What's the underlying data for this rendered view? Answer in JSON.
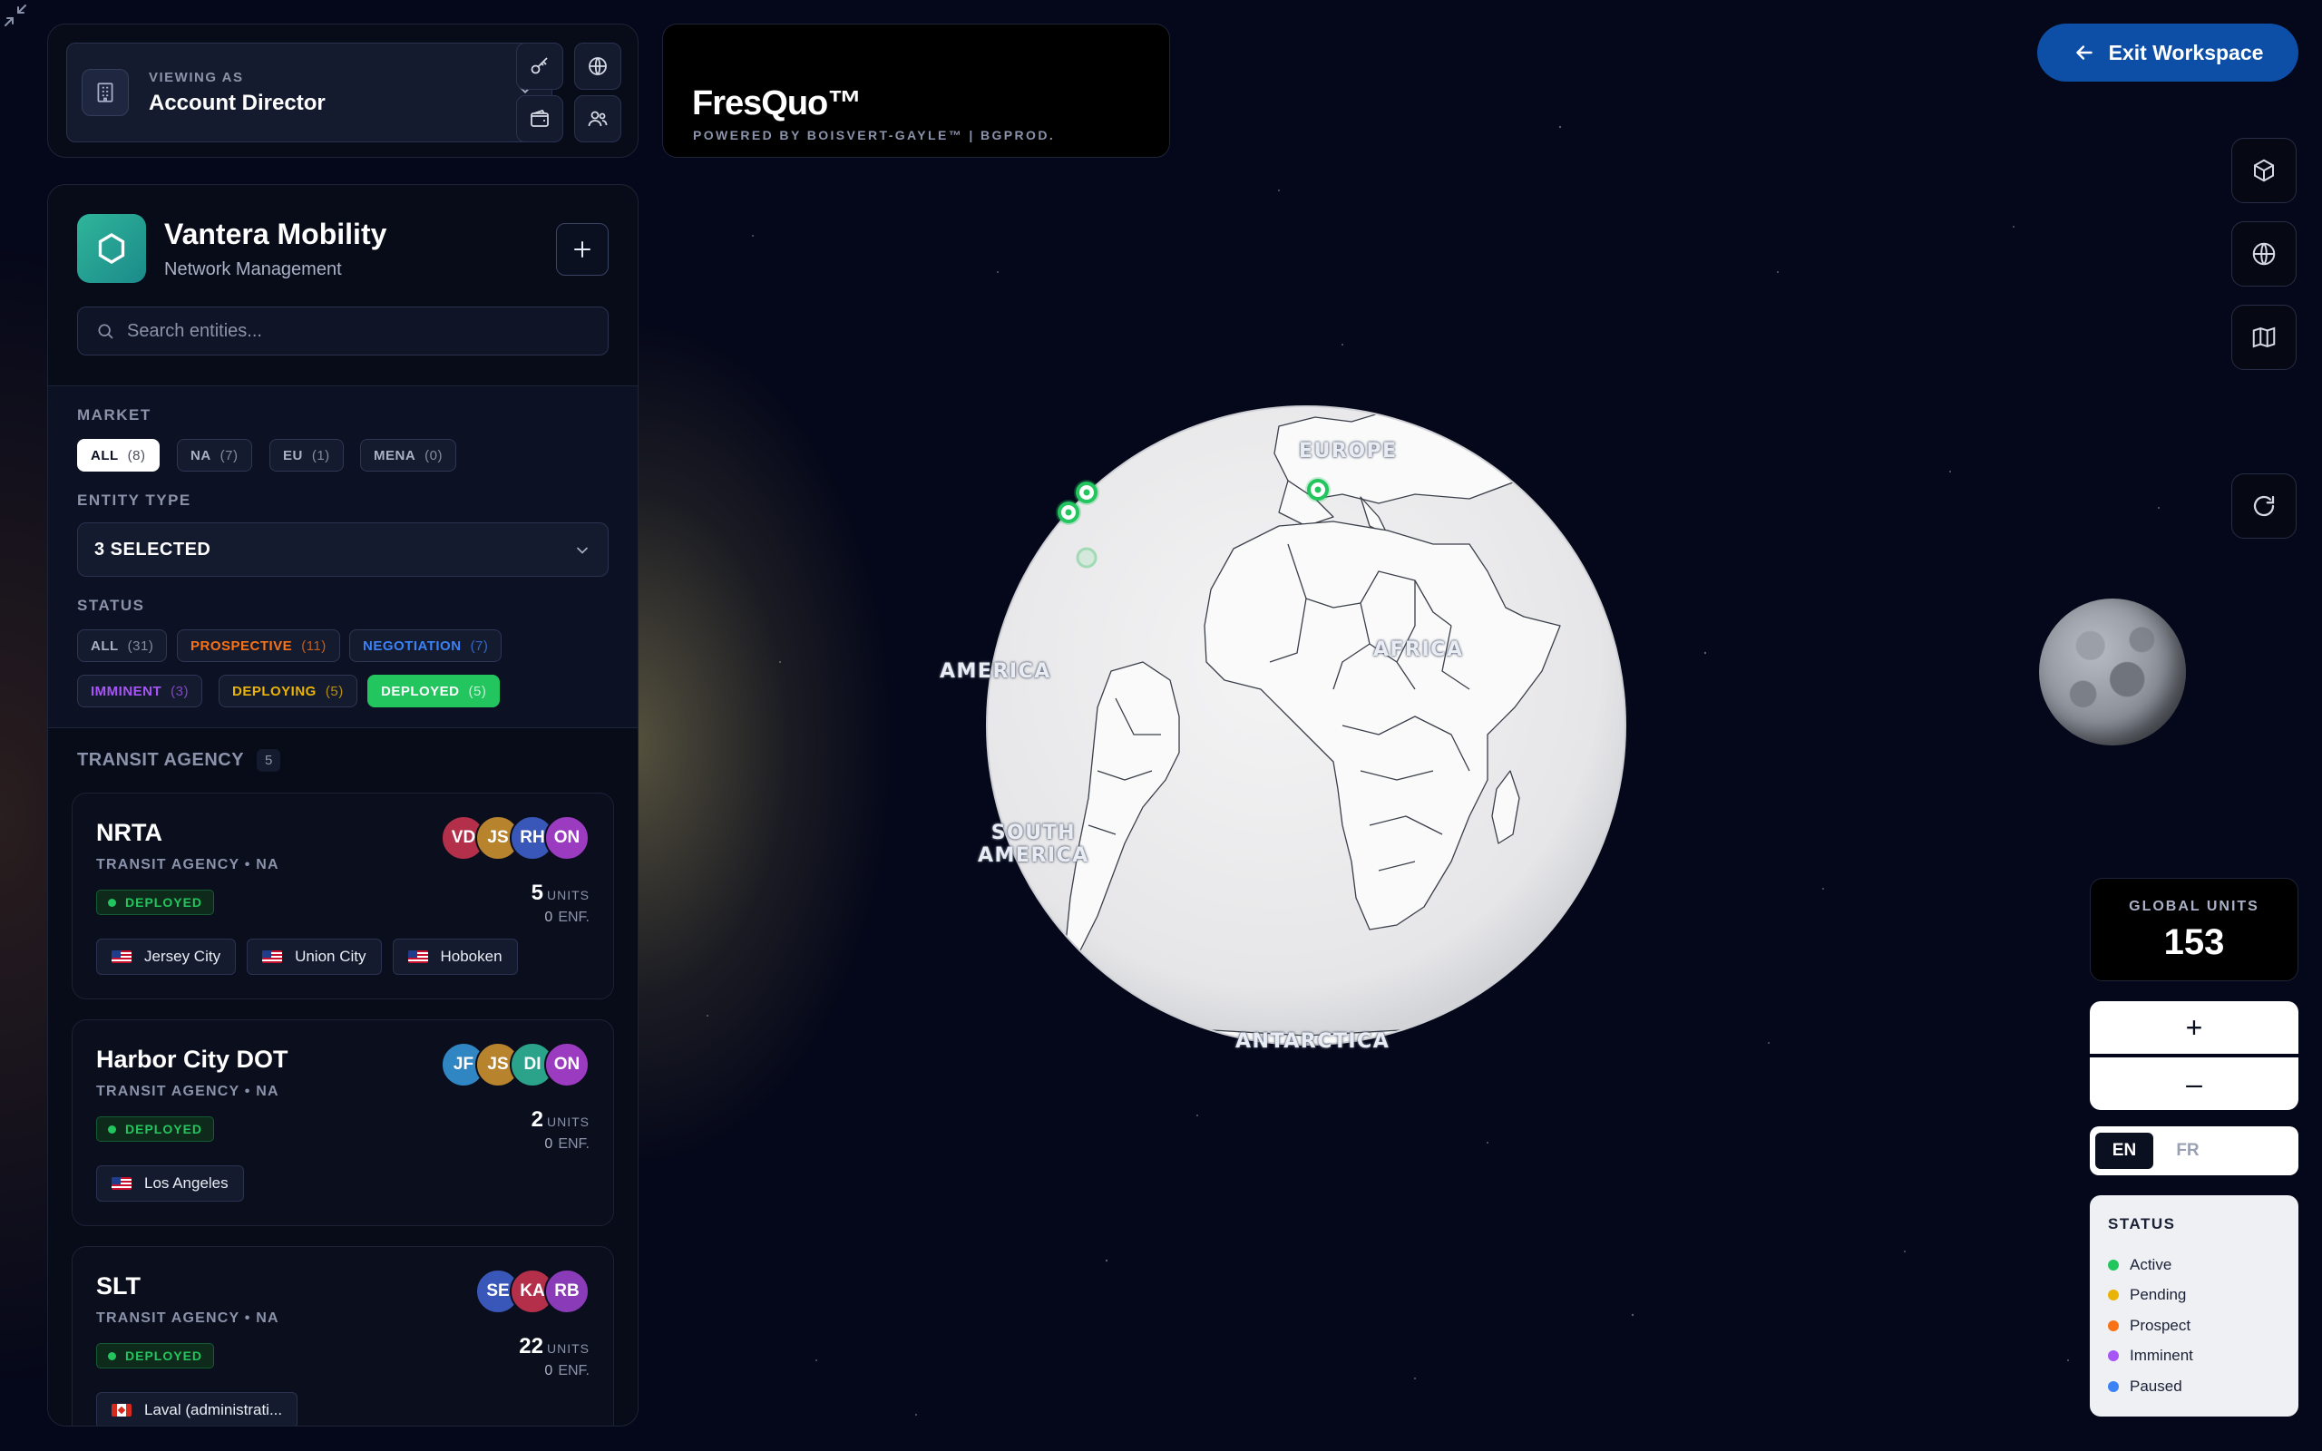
{
  "header": {
    "viewing_label": "VIEWING AS",
    "viewing_value": "Account Director",
    "brand_name": "FresQuo™",
    "brand_sub": "POWERED BY BOISVERT-GAYLE™ | BGPROD.",
    "exit_label": "Exit Workspace"
  },
  "sidebar": {
    "workspace_name": "Vantera Mobility",
    "workspace_sub": "Network Management",
    "search_placeholder": "Search entities...",
    "market_label": "MARKET",
    "market_chips": [
      {
        "label": "ALL",
        "count": "(8)"
      },
      {
        "label": "NA",
        "count": "(7)"
      },
      {
        "label": "EU",
        "count": "(1)"
      },
      {
        "label": "MENA",
        "count": "(0)"
      }
    ],
    "entity_type_label": "ENTITY TYPE",
    "entity_type_value": "3 SELECTED",
    "status_label": "STATUS",
    "status_chips": [
      {
        "label": "ALL",
        "count": "(31)",
        "color": "#aab1c6"
      },
      {
        "label": "PROSPECTIVE",
        "count": "(11)",
        "color": "#f97316"
      },
      {
        "label": "NEGOTIATION",
        "count": "(7)",
        "color": "#3b82f6"
      },
      {
        "label": "IMMINENT",
        "count": "(3)",
        "color": "#a855f7"
      },
      {
        "label": "DEPLOYING",
        "count": "(5)",
        "color": "#eab308"
      },
      {
        "label": "DEPLOYED",
        "count": "(5)",
        "color": "#ffffff"
      }
    ],
    "group_title": "TRANSIT AGENCY",
    "group_count": "5",
    "entities": [
      {
        "name": "NRTA",
        "meta": "TRANSIT AGENCY • NA",
        "status": "DEPLOYED",
        "units": "5",
        "units_label": "UNITS",
        "enf": "0",
        "enf_label": "ENF.",
        "avatars": [
          {
            "initials": "VD",
            "color": "#b4304a"
          },
          {
            "initials": "JS",
            "color": "#b7832c"
          },
          {
            "initials": "RH",
            "color": "#3957b8"
          },
          {
            "initials": "ON",
            "color": "#9b3bbf"
          }
        ],
        "locations": [
          {
            "flag": "us",
            "name": "Jersey City"
          },
          {
            "flag": "us",
            "name": "Union City"
          },
          {
            "flag": "us",
            "name": "Hoboken"
          }
        ]
      },
      {
        "name": "Harbor City DOT",
        "meta": "TRANSIT AGENCY • NA",
        "status": "DEPLOYED",
        "units": "2",
        "units_label": "UNITS",
        "enf": "0",
        "enf_label": "ENF.",
        "avatars": [
          {
            "initials": "JF",
            "color": "#2f86c2"
          },
          {
            "initials": "JS",
            "color": "#b7832c"
          },
          {
            "initials": "DI",
            "color": "#2aa38a"
          },
          {
            "initials": "ON",
            "color": "#9b3bbf"
          }
        ],
        "locations": [
          {
            "flag": "us",
            "name": "Los Angeles"
          }
        ]
      },
      {
        "name": "SLT",
        "meta": "TRANSIT AGENCY • NA",
        "status": "DEPLOYED",
        "units": "22",
        "units_label": "UNITS",
        "enf": "0",
        "enf_label": "ENF.",
        "avatars": [
          {
            "initials": "SE",
            "color": "#3957b8"
          },
          {
            "initials": "KA",
            "color": "#b4304a"
          },
          {
            "initials": "RB",
            "color": "#8a3bb8"
          }
        ],
        "locations": [
          {
            "flag": "ca",
            "name": "Laval (administrati..."
          }
        ]
      }
    ]
  },
  "map": {
    "labels": {
      "europe": "EUROPE",
      "africa": "AFRICA",
      "america": "AMERICA",
      "south_america_1": "SOUTH",
      "south_america_2": "AMERICA",
      "antarctica": "ANTARCTICA"
    }
  },
  "controls": {
    "global_units_label": "GLOBAL UNITS",
    "global_units_value": "153",
    "zoom_in": "+",
    "zoom_out": "–",
    "lang_en": "EN",
    "lang_fr": "FR",
    "legend_title": "STATUS",
    "legend": [
      {
        "label": "Active",
        "color": "#22c55e"
      },
      {
        "label": "Pending",
        "color": "#eab308"
      },
      {
        "label": "Prospect",
        "color": "#f97316"
      },
      {
        "label": "Imminent",
        "color": "#a855f7"
      },
      {
        "label": "Paused",
        "color": "#3b82f6"
      }
    ]
  }
}
